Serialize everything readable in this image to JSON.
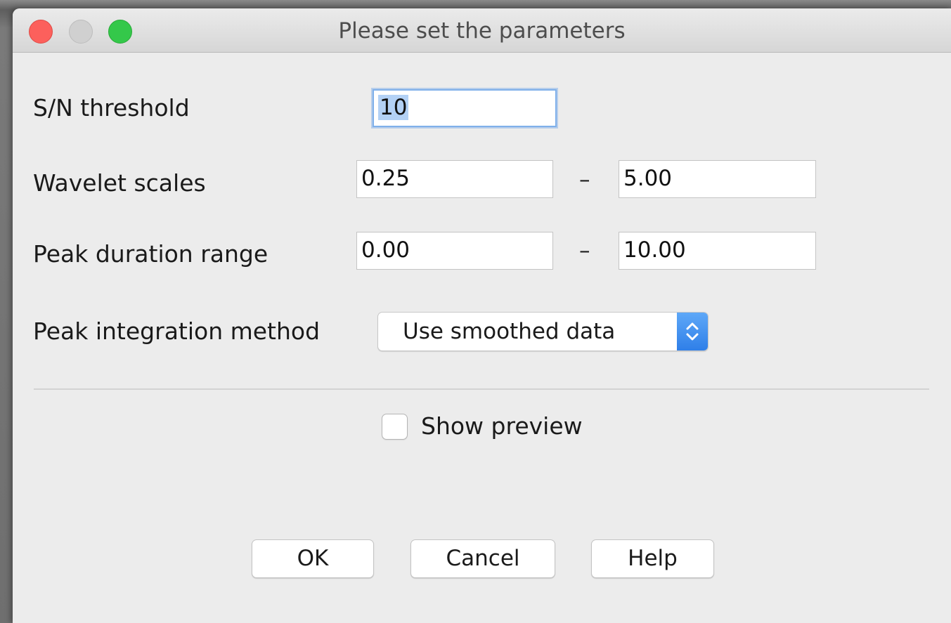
{
  "window": {
    "title": "Please set the parameters"
  },
  "fields": {
    "sn_threshold": {
      "label": "S/N threshold",
      "value": "10"
    },
    "wavelet_scales": {
      "label": "Wavelet scales",
      "min": "0.25",
      "separator": "–",
      "max": "5.00"
    },
    "peak_duration": {
      "label": "Peak duration range",
      "min": "0.00",
      "separator": "–",
      "max": "10.00"
    },
    "integration": {
      "label": "Peak integration method",
      "selected": "Use smoothed data"
    }
  },
  "preview": {
    "label": "Show preview",
    "checked": false
  },
  "buttons": {
    "ok": "OK",
    "cancel": "Cancel",
    "help": "Help"
  },
  "colors": {
    "close": "#fc605c",
    "minimize": "#d0d0d0",
    "zoom": "#34c84a",
    "focus_ring": "#7fb0ea",
    "selection": "#b3d1f5",
    "select_accent": "#2f7fe8"
  },
  "icons": {
    "select_arrows": "chevron-up-down-icon"
  }
}
